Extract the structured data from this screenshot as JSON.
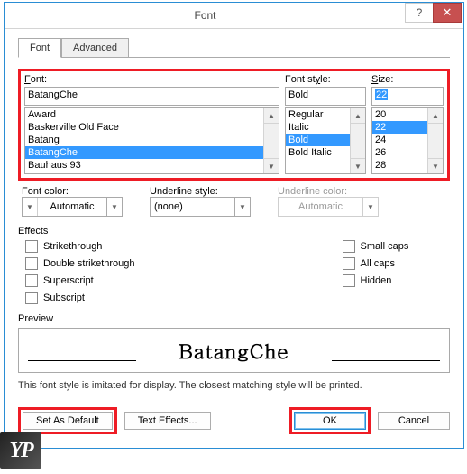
{
  "window": {
    "title": "Font",
    "help_glyph": "?",
    "close_glyph": "✕"
  },
  "tabs": {
    "font": "Font",
    "advanced": "Advanced"
  },
  "labels": {
    "font": "Font:",
    "font_style": "Font style:",
    "size": "Size:",
    "font_color": "Font color:",
    "underline_style": "Underline style:",
    "underline_color": "Underline color:",
    "effects": "Effects",
    "preview": "Preview",
    "note": "This font style is imitated for display. The closest matching style will be printed."
  },
  "font_input": "BatangChe",
  "style_input": "Bold",
  "size_input": "22",
  "font_list": [
    "Award",
    "Baskerville Old Face",
    "Batang",
    "BatangChe",
    "Bauhaus 93"
  ],
  "font_selected": "BatangChe",
  "style_list": [
    "Regular",
    "Italic",
    "Bold",
    "Bold Italic"
  ],
  "style_selected": "Bold",
  "size_list": [
    "20",
    "22",
    "24",
    "26",
    "28"
  ],
  "size_selected": "22",
  "dropdowns": {
    "font_color": "Automatic",
    "underline_style": "(none)",
    "underline_color": "Automatic"
  },
  "effects": {
    "strikethrough": "Strikethrough",
    "double_strike": "Double strikethrough",
    "superscript": "Superscript",
    "subscript": "Subscript",
    "small_caps": "Small caps",
    "all_caps": "All caps",
    "hidden": "Hidden"
  },
  "preview_text": "BatangChe",
  "buttons": {
    "default": "Default...",
    "text_effects": "Text Effects...",
    "ok": "OK",
    "cancel": "Cancel"
  },
  "logo": "YP"
}
